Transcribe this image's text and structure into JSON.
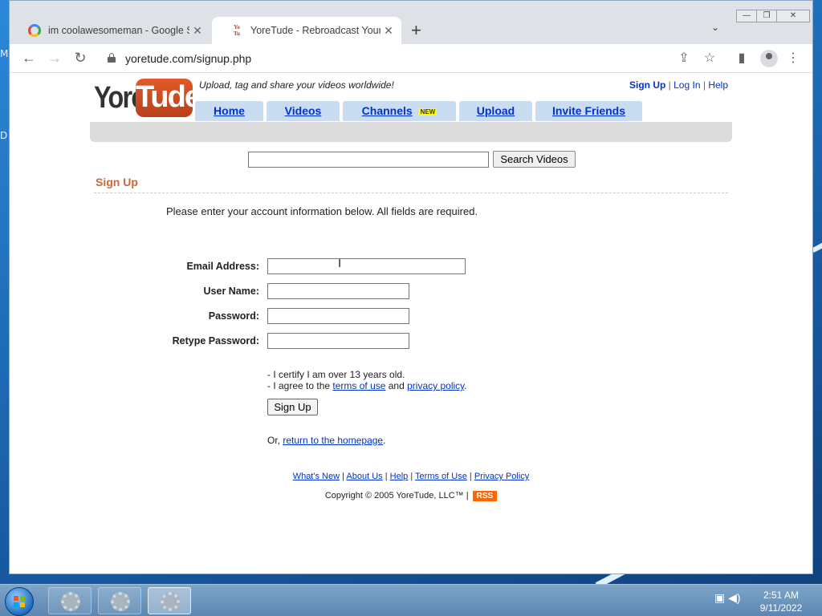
{
  "browser": {
    "tabs": [
      {
        "title": "im coolawesomeman - Google S",
        "active": false
      },
      {
        "title": "YoreTude - Rebroadcast Yourself.",
        "active": true
      }
    ],
    "new_tab": "+",
    "url": "yoretude.com/signup.php"
  },
  "site": {
    "logo_text_1": "Yore",
    "logo_text_2": "Tude",
    "tagline": "Upload, tag and share your videos worldwide!",
    "utility_links": {
      "signup": "Sign Up",
      "login": "Log In",
      "help": "Help",
      "sep": "|"
    },
    "nav": [
      {
        "label": "Home"
      },
      {
        "label": "Videos"
      },
      {
        "label": "Channels",
        "badge": "NEW"
      },
      {
        "label": "Upload"
      },
      {
        "label": "Invite Friends"
      }
    ],
    "search": {
      "value": "",
      "button": "Search Videos"
    }
  },
  "signup": {
    "heading": "Sign Up",
    "intro": "Please enter your account information below. All fields are required.",
    "fields": {
      "email": "Email Address:",
      "username": "User Name:",
      "password": "Password:",
      "retype": "Retype Password:"
    },
    "cert_1": "- I certify I am over 13 years old.",
    "cert_2_prefix": "- I agree to the ",
    "terms_link": "terms of use",
    "and": " and ",
    "privacy_link": "privacy policy",
    "period": ".",
    "button": "Sign Up",
    "or_prefix": "Or, ",
    "return_link": "return to the homepage",
    "or_suffix": "."
  },
  "footer": {
    "links": [
      "What's New",
      "About Us",
      "Help",
      "Terms of Use",
      "Privacy Policy"
    ],
    "copyright": "Copyright © 2005 YoreTude, LLC™ |",
    "rss": "RSS"
  },
  "taskbar": {
    "time": "2:51 AM",
    "date": "9/11/2022"
  },
  "colors": {
    "accent_orange": "#cc6633",
    "link_blue": "#0033cc",
    "nav_tab": "#cadcf0"
  }
}
